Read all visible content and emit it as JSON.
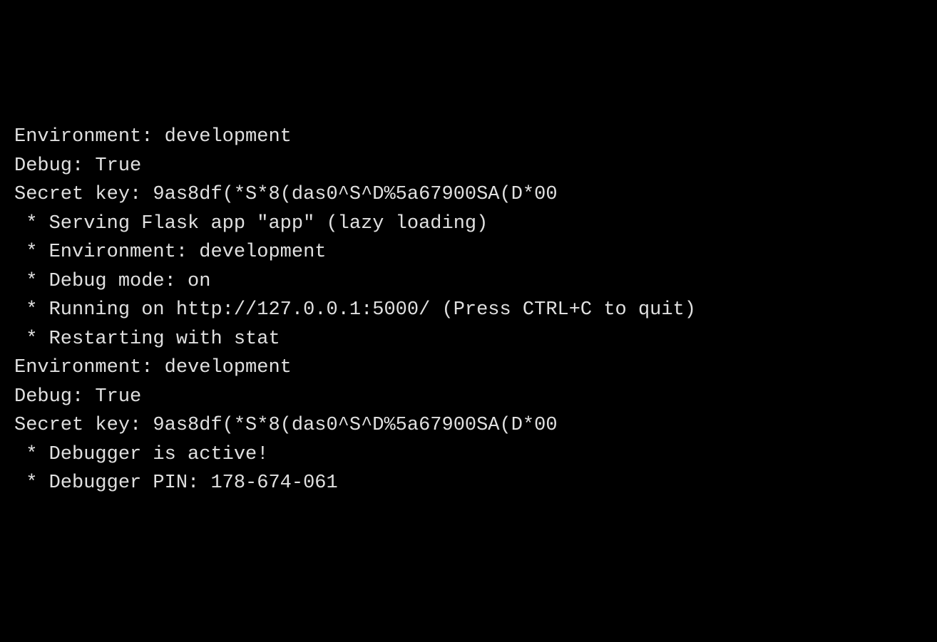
{
  "terminal": {
    "lines": [
      "Environment: development",
      "Debug: True",
      "Secret key: 9as8df(*S*8(das0^S^D%5a67900SA(D*00",
      " * Serving Flask app \"app\" (lazy loading)",
      " * Environment: development",
      " * Debug mode: on",
      " * Running on http://127.0.0.1:5000/ (Press CTRL+C to quit)",
      " * Restarting with stat",
      "Environment: development",
      "Debug: True",
      "Secret key: 9as8df(*S*8(das0^S^D%5a67900SA(D*00",
      " * Debugger is active!",
      " * Debugger PIN: 178-674-061"
    ]
  }
}
